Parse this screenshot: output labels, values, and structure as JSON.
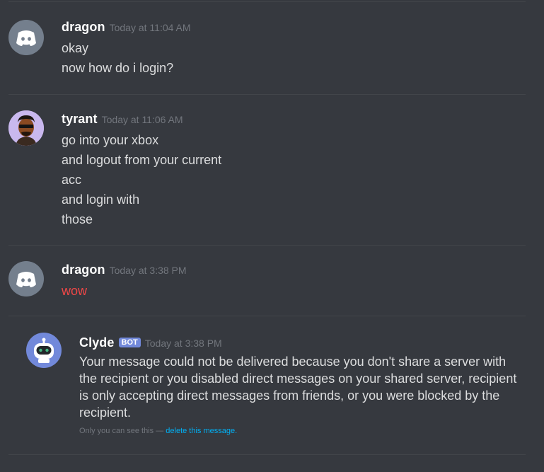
{
  "messages": [
    {
      "username": "dragon",
      "timestamp": "Today at 11:04 AM",
      "lines": [
        "okay",
        "now how do i login?"
      ]
    },
    {
      "username": "tyrant",
      "timestamp": "Today at 11:06 AM",
      "lines": [
        "go into your xbox",
        "and logout from your current",
        "acc",
        "and login with",
        "those"
      ]
    },
    {
      "username": "dragon",
      "timestamp": "Today at 3:38 PM",
      "lines": [
        "wow"
      ]
    }
  ],
  "system_message": {
    "username": "Clyde",
    "badge": "BOT",
    "timestamp": "Today at 3:38 PM",
    "text": "Your message could not be delivered because you don't share a server with the recipient or you disabled direct messages on your shared server, recipient is only accepting direct messages from friends, or you were blocked by the recipient.",
    "notice_prefix": "Only you can see this — ",
    "notice_link": "delete this message."
  },
  "icons": {
    "dragon_avatar": "discord-logo-icon",
    "tyrant_avatar": "user-portrait-icon",
    "clyde_avatar": "robot-icon"
  },
  "colors": {
    "background": "#36393f",
    "failed_message": "#f04747",
    "link": "#00b0f4",
    "bot_badge": "#7289da",
    "clyde_avatar_bg": "#7289da",
    "dragon_avatar_bg": "#747f8d"
  }
}
